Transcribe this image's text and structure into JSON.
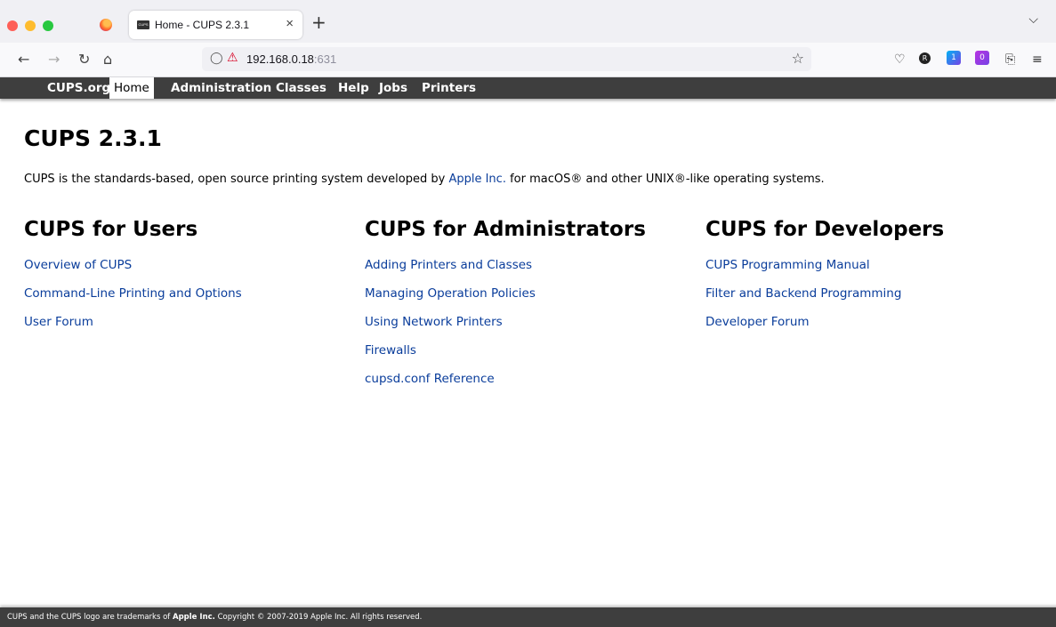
{
  "browser": {
    "tab_title": "Home - CUPS 2.3.1",
    "favicon_text": "CUPS",
    "close_glyph": "×",
    "new_tab_glyph": "+",
    "url_host": "192.168.0.18",
    "url_port": ":631",
    "ext_badge_1": "1",
    "ext_badge_2": "0"
  },
  "nav": {
    "items": [
      "CUPS.org",
      "Home",
      "Administration",
      "Classes",
      "Help",
      "Jobs",
      "Printers"
    ],
    "active": "Home"
  },
  "main": {
    "title": "CUPS 2.3.1",
    "intro_before": "CUPS is the standards-based, open source printing system developed by ",
    "intro_link": "Apple Inc.",
    "intro_after": " for macOS® and other UNIX®-like operating systems.",
    "columns": [
      {
        "heading": "CUPS for Users",
        "links": [
          "Overview of CUPS",
          "Command-Line Printing and Options",
          "User Forum"
        ]
      },
      {
        "heading": "CUPS for Administrators",
        "links": [
          "Adding Printers and Classes",
          "Managing Operation Policies",
          "Using Network Printers",
          "Firewalls",
          "cupsd.conf Reference"
        ]
      },
      {
        "heading": "CUPS for Developers",
        "links": [
          "CUPS Programming Manual",
          "Filter and Backend Programming",
          "Developer Forum"
        ]
      }
    ]
  },
  "footer": {
    "before": "CUPS and the CUPS logo are trademarks of ",
    "bold": "Apple Inc.",
    "after": " Copyright © 2007-2019 Apple Inc. All rights reserved."
  }
}
